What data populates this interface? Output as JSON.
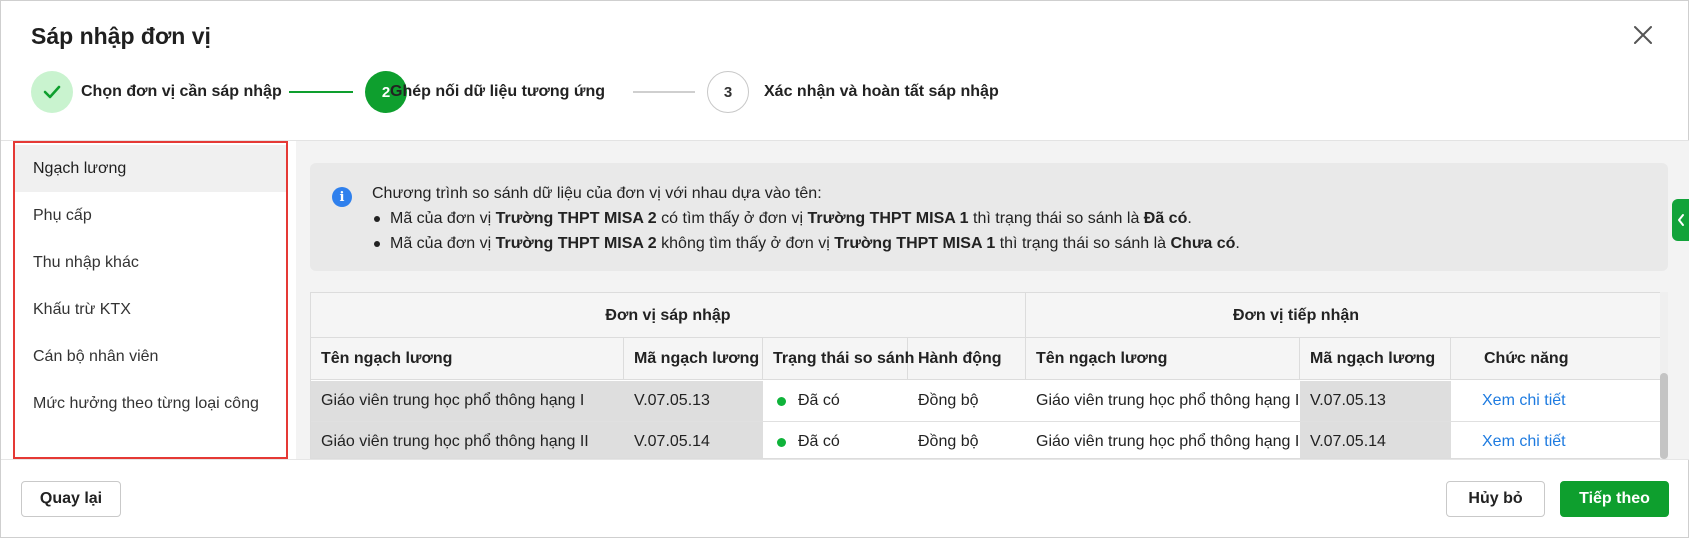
{
  "dialog": {
    "title": "Sáp nhập đơn vị"
  },
  "stepper": {
    "steps": [
      {
        "number": "",
        "label": "Chọn đơn vị cần sáp nhập",
        "state": "done"
      },
      {
        "number": "2",
        "label": "Ghép nối dữ liệu tương ứng",
        "state": "active"
      },
      {
        "number": "3",
        "label": "Xác nhận và hoàn tất sáp nhập",
        "state": "todo"
      }
    ]
  },
  "sidebar": {
    "items": [
      {
        "label": "Ngạch lương",
        "selected": true
      },
      {
        "label": "Phụ cấp"
      },
      {
        "label": "Thu nhập khác"
      },
      {
        "label": "Khấu trừ KTX"
      },
      {
        "label": "Cán bộ nhân viên"
      },
      {
        "label": "Mức hưởng theo từng loại công"
      }
    ]
  },
  "info": {
    "intro": "Chương trình so sánh dữ liệu của đơn vị với nhau dựa vào tên:",
    "line1": {
      "p1": "Mã của đơn vị ",
      "unit_a": "Trường THPT MISA 2",
      "p2": " có tìm thấy ở đơn vị ",
      "unit_b": "Trường THPT MISA 1",
      "p3": " thì trạng thái so sánh là ",
      "status": "Đã có",
      "end": "."
    },
    "line2": {
      "p1": "Mã của đơn vị ",
      "unit_a": "Trường THPT MISA 2",
      "p2": " không tìm thấy ở đơn vị ",
      "unit_b": "Trường THPT MISA 1",
      "p3": " thì trạng thái so sánh là ",
      "status": "Chưa có",
      "end": "."
    }
  },
  "table": {
    "groups": {
      "source": "Đơn vị sáp nhập",
      "target": "Đơn vị tiếp nhận"
    },
    "columns": {
      "name": "Tên ngạch lương",
      "code": "Mã ngạch lương",
      "status": "Trạng thái so sánh",
      "action": "Hành động",
      "target_name": "Tên ngạch lương",
      "target_code": "Mã ngạch lương",
      "function": "Chức năng"
    },
    "rows": [
      {
        "name": "Giáo viên trung học phổ thông hạng I",
        "code": "V.07.05.13",
        "status": "Đã có",
        "action": "Đồng bộ",
        "target_name": "Giáo viên trung học phổ thông hạng I",
        "target_code": "V.07.05.13",
        "function": "Xem chi tiết"
      },
      {
        "name": "Giáo viên trung học phổ thông hạng II",
        "code": "V.07.05.14",
        "status": "Đã có",
        "action": "Đồng bộ",
        "target_name": "Giáo viên trung học phổ thông hạng II",
        "target_code": "V.07.05.14",
        "function": "Xem chi tiết"
      }
    ]
  },
  "footer": {
    "back": "Quay lại",
    "cancel": "Hủy bỏ",
    "next": "Tiếp theo"
  },
  "colors": {
    "primary_green": "#0e9f2e",
    "status_dot": "#0fb33a",
    "link": "#1e7be0",
    "highlight_border": "#e53935",
    "info_icon": "#2f80ed"
  },
  "icons": {
    "close": "close-icon",
    "done_step": "check-icon",
    "info": "info-icon",
    "toggle": "chevron-left-icon"
  }
}
